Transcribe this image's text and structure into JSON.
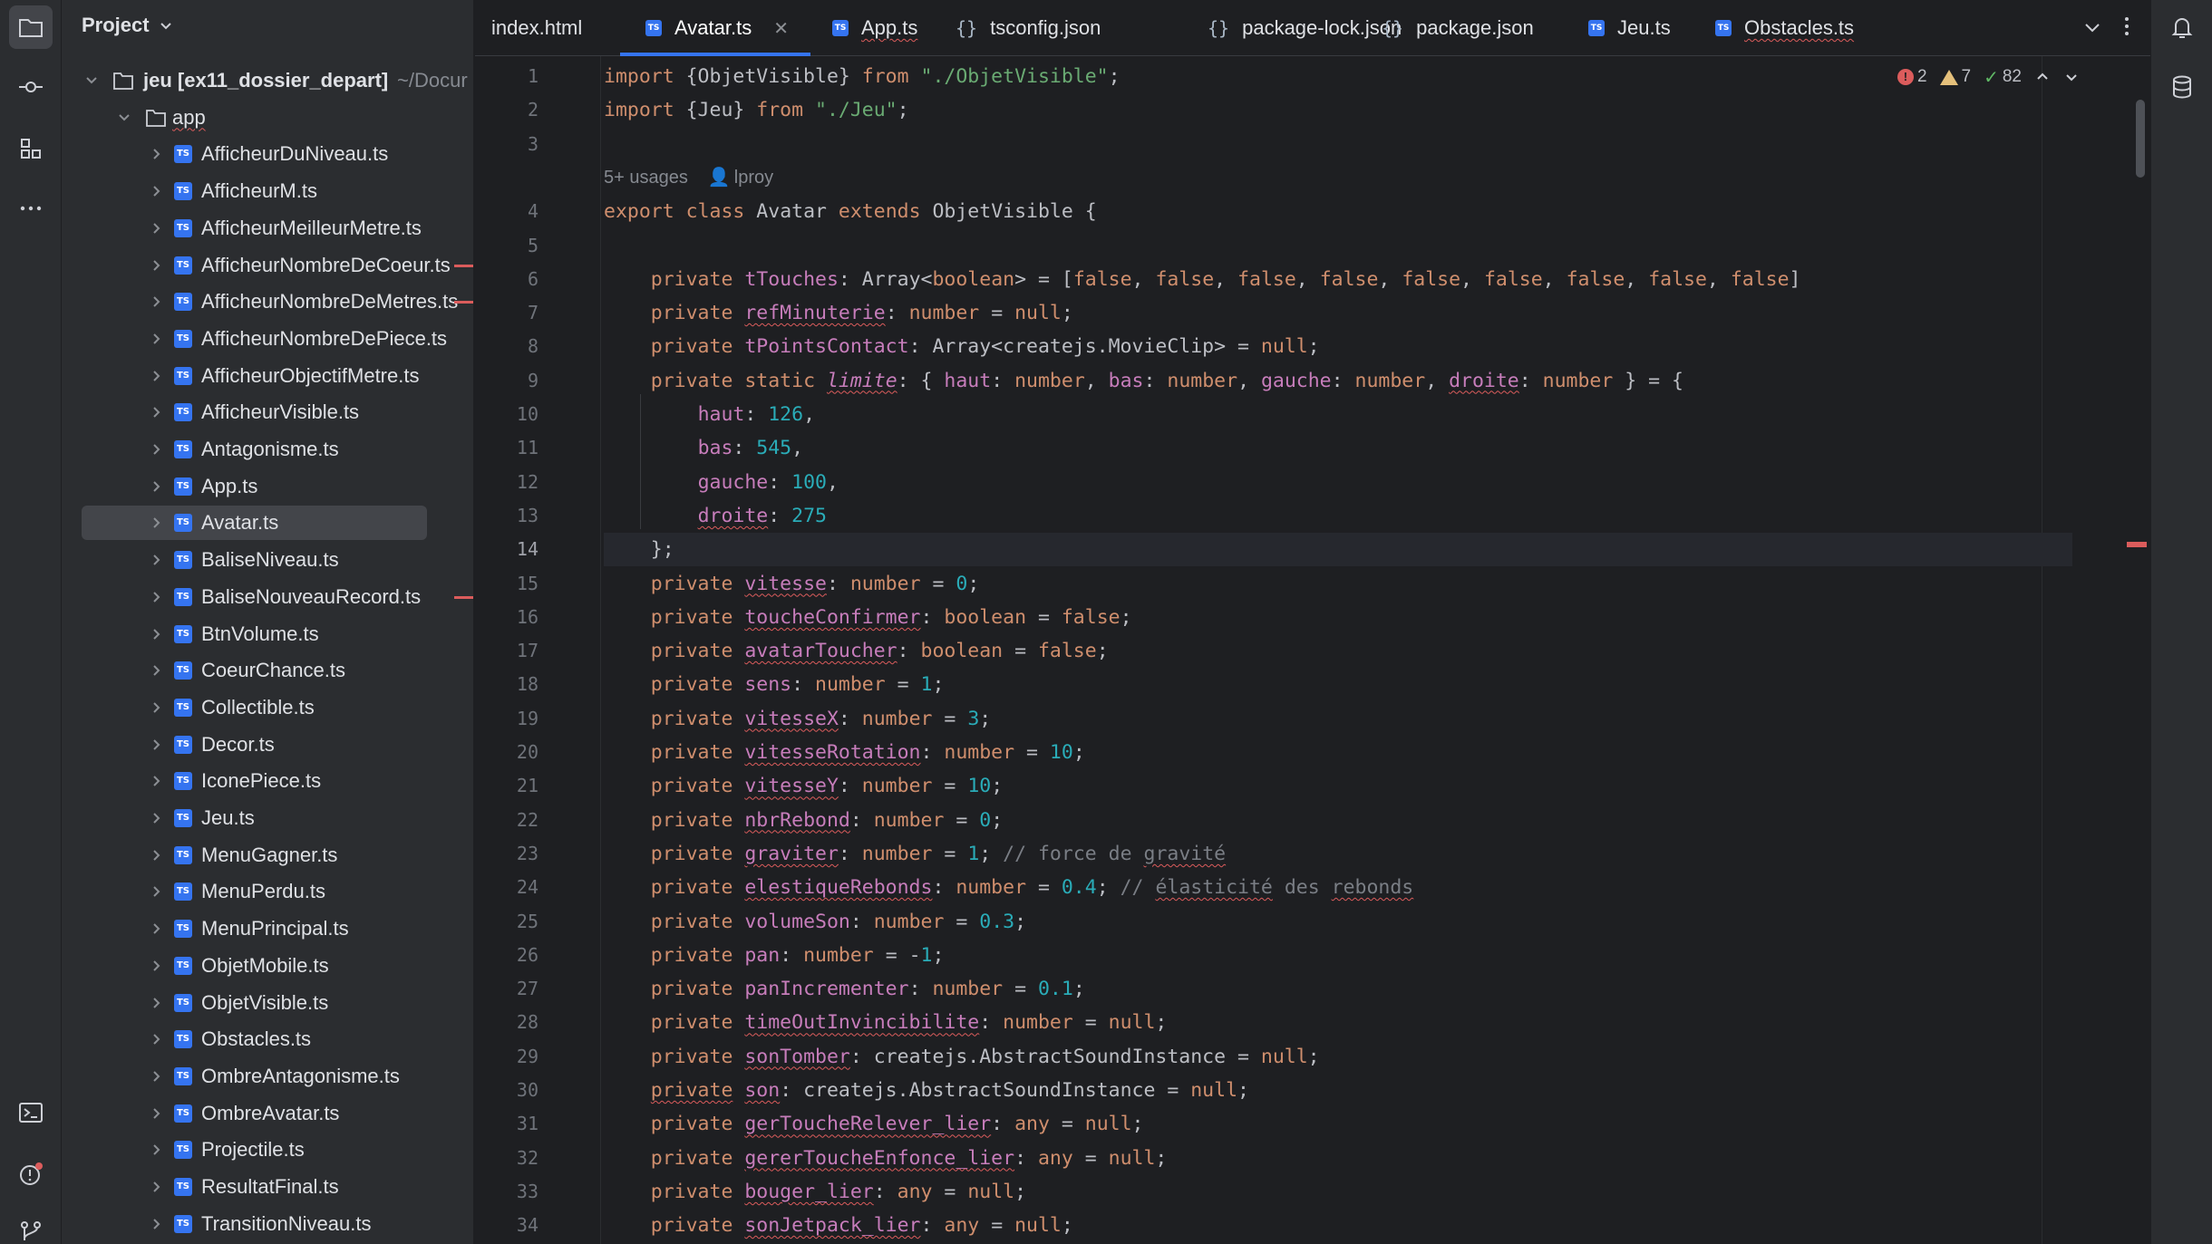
{
  "project_panel": {
    "title": "Project",
    "root": {
      "name": "jeu [ex11_dossier_depart]",
      "path": "~/Docur"
    },
    "folder": "app",
    "files": [
      "AfficheurDuNiveau.ts",
      "AfficheurM.ts",
      "AfficheurMeilleurMetre.ts",
      "AfficheurNombreDeCoeur.ts",
      "AfficheurNombreDeMetres.ts",
      "AfficheurNombreDePiece.ts",
      "AfficheurObjectifMetre.ts",
      "AfficheurVisible.ts",
      "Antagonisme.ts",
      "App.ts",
      "Avatar.ts",
      "BaliseNiveau.ts",
      "BaliseNouveauRecord.ts",
      "BtnVolume.ts",
      "CoeurChance.ts",
      "Collectible.ts",
      "Decor.ts",
      "IconePiece.ts",
      "Jeu.ts",
      "MenuGagner.ts",
      "MenuPerdu.ts",
      "MenuPrincipal.ts",
      "ObjetMobile.ts",
      "ObjetVisible.ts",
      "Obstacles.ts",
      "OmbreAntagonisme.ts",
      "OmbreAvatar.ts",
      "Projectile.ts",
      "ResultatFinal.ts",
      "TransitionNiveau.ts"
    ],
    "selected_file": "Avatar.ts"
  },
  "tabs": [
    {
      "label": "index.html",
      "icon": "html-file-icon"
    },
    {
      "label": "Avatar.ts",
      "icon": "ts-file-icon",
      "active": true
    },
    {
      "label": "App.ts",
      "icon": "ts-file-icon"
    },
    {
      "label": "tsconfig.json",
      "icon": "json-file-icon"
    },
    {
      "label": "package-lock.json",
      "icon": "json-file-icon"
    },
    {
      "label": "package.json",
      "icon": "json-file-icon"
    },
    {
      "label": "Jeu.ts",
      "icon": "ts-file-icon"
    },
    {
      "label": "Obstacles.ts",
      "icon": "ts-file-icon"
    }
  ],
  "inspections": {
    "errors": "2",
    "warnings": "7",
    "ok": "82"
  },
  "inlay": {
    "usages": "5+ usages",
    "author": "lproy"
  },
  "current_line": "14",
  "line_numbers": [
    "1",
    "2",
    "3",
    "4",
    "5",
    "6",
    "7",
    "8",
    "9",
    "10",
    "11",
    "12",
    "13",
    "14",
    "15",
    "16",
    "17",
    "18",
    "19",
    "20",
    "21",
    "22",
    "23",
    "24",
    "25",
    "26",
    "27",
    "28",
    "29",
    "30",
    "31",
    "32",
    "33",
    "34"
  ],
  "code_lines": [
    "import {ObjetVisible} from \"./ObjetVisible\";",
    "import {Jeu} from \"./Jeu\";",
    "",
    "export class Avatar extends ObjetVisible {",
    "",
    "    private tTouches: Array<boolean> = [false, false, false, false, false, false, false, false, false]",
    "    private refMinuterie: number = null;",
    "    private tPointsContact: Array<createjs.MovieClip> = null;",
    "    private static limite: { haut: number, bas: number, gauche: number, droite: number } = {",
    "        haut: 126,",
    "        bas: 545,",
    "        gauche: 100,",
    "        droite: 275",
    "    };",
    "    private vitesse: number = 0;",
    "    private toucheConfirmer: boolean = false;",
    "    private avatarToucher: boolean = false;",
    "    private sens: number = 1;",
    "    private vitesseX: number = 3;",
    "    private vitesseRotation: number = 10;",
    "    private vitesseY: number = 10;",
    "    private nbrRebond: number = 0;",
    "    private graviter: number = 1; // force de gravité",
    "    private elestiqueRebonds: number = 0.4; // élasticité des rebonds",
    "    private volumeSon: number = 0.3;",
    "    private pan: number = -1;",
    "    private panIncrementer: number = 0.1;",
    "    private timeOutInvincibilite: number = null;",
    "    private sonTomber: createjs.AbstractSoundInstance = null;",
    "    private son: createjs.AbstractSoundInstance = null;",
    "    private gerToucheRelever_lier: any = null;",
    "    private gererToucheEnfonce_lier: any = null;",
    "    private bouger_lier: any = null;",
    "    private sonJetpack_lier: any = null;"
  ]
}
